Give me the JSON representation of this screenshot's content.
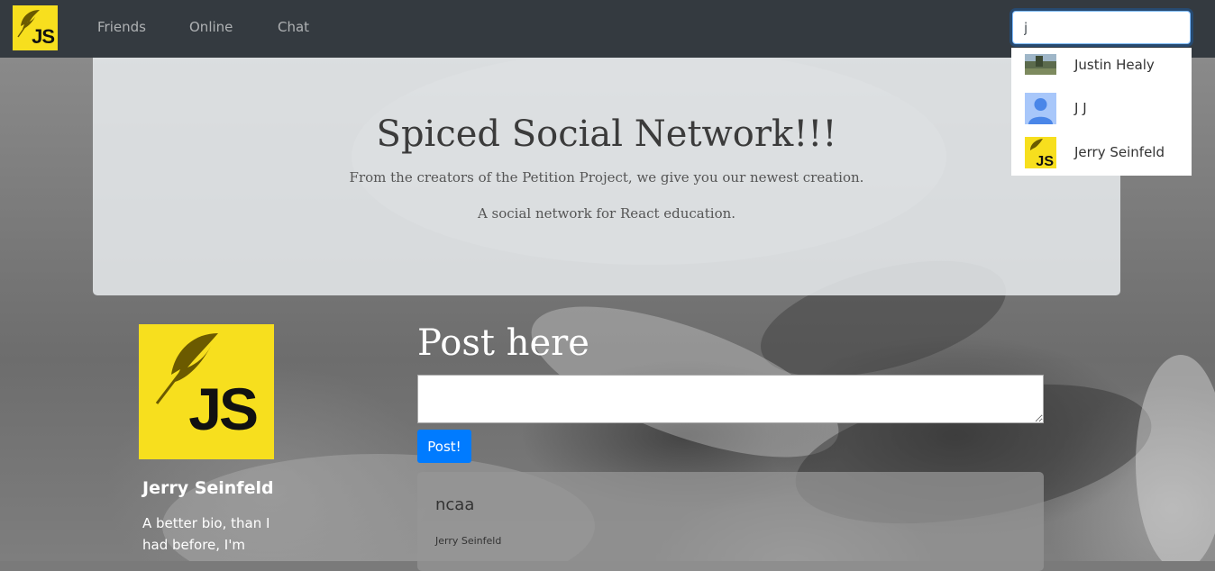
{
  "navbar": {
    "logo_text": "JS",
    "links": [
      {
        "label": "Friends"
      },
      {
        "label": "Online"
      },
      {
        "label": "Chat"
      }
    ],
    "search": {
      "value": "j",
      "placeholder": ""
    }
  },
  "search_results": [
    {
      "name": "Justin Healy",
      "thumb": "landscape-photo"
    },
    {
      "name": "J J",
      "thumb": "default-user-avatar"
    },
    {
      "name": "Jerry Seinfeld",
      "thumb": "js-logo"
    }
  ],
  "jumbotron": {
    "title": "Spiced Social Network!!!",
    "subtitle": "From the creators of the Petition Project, we give you our newest creation.",
    "tagline": "A social network for React education."
  },
  "profile": {
    "avatar_text": "JS",
    "name": "Jerry Seinfeld",
    "bio": "A better bio, than I had before, I'm"
  },
  "wall": {
    "heading": "Post here",
    "textarea_value": "",
    "post_button": "Post!",
    "posts": [
      {
        "text": "ncaa",
        "author": "Jerry Seinfeld"
      }
    ]
  },
  "colors": {
    "navbar": "#343a40",
    "js_yellow": "#f7df1e",
    "primary": "#007bff"
  }
}
